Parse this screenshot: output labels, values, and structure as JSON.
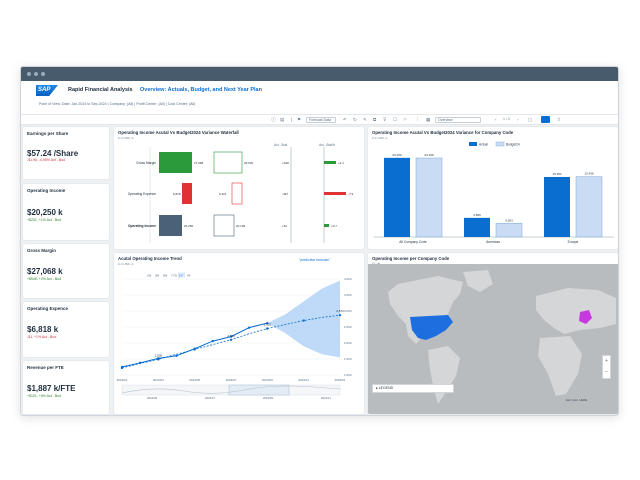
{
  "app": {
    "brand": "SAP",
    "title": "Rapid Financial Analysis",
    "story_title": "Overview: Actuals, Budget, and Next Year Plan",
    "point_of_view": "Point of View: Date: Jan,2024 to Sep,2024 | Company: (All) | Profit Center: (All) | Cost Center: (All)"
  },
  "toolbar": {
    "version_select": "Forecast Data",
    "page_indicator": "1 / 3",
    "page_select": "Overview"
  },
  "colors": {
    "accent": "#0a6ed1",
    "positive": "#2b9a3a",
    "negative": "#e03232",
    "actual_bar": "#0a6ed1",
    "budget_bar": "#c9dcf3",
    "forecast_band": "#a9cdf5",
    "map_highlight": "#1d6fe0",
    "map_highlight_2": "#c738e0"
  },
  "kpis": [
    {
      "title": "Earnings per Share",
      "value": "$57.24 /Share",
      "delta": "-$1.96, -4.95% Act - Bud",
      "trend": "negative"
    },
    {
      "title": "Operating Income",
      "value": "$20,250 k",
      "delta": "+$231, +1% Act - Bud",
      "trend": "positive"
    },
    {
      "title": "Gross Margin",
      "value": "$27,068 k",
      "delta": "+$548, +2% Act - Bud",
      "trend": "positive"
    },
    {
      "title": "Operating Expence",
      "value": "$6,818 k",
      "delta": "-$1, +1% Act - Bud",
      "trend": "negative"
    },
    {
      "title": "Revenue per FTE",
      "value": "$1,887 k/FTE",
      "delta": "+$101, +5% Act - Bud",
      "trend": "positive"
    }
  ],
  "waterfall": {
    "title": "Operating Income Acutal Vs Budget2024 Variance Waterfall",
    "subtitle": "in k USD, A",
    "col_act_bud": "Act - Bud",
    "col_act_budpct": "Act - Bud%",
    "rows": [
      {
        "label": "Gross Margin",
        "actual": "27,068",
        "budget": "26,520",
        "diff": "+548",
        "pct": "+2.1"
      },
      {
        "label": "Operating Expence",
        "actual": "6,818",
        "budget": "6,321",
        "diff": "-497",
        "pct": "-7.9"
      },
      {
        "label": "Operating Income",
        "actual": "20,250",
        "budget": "20,199",
        "diff": "+51",
        "pct": "+0.7"
      }
    ]
  },
  "company_chart": {
    "title": "Operating Income Acutal Vs Budget2024 Variance for Company Code",
    "subtitle": "in k USD, A",
    "legend": [
      "Actual",
      "Budget24"
    ],
    "chart_data": {
      "type": "bar",
      "categories": [
        "All Company Code",
        "Americas",
        "Europe"
      ],
      "series": [
        {
          "name": "Actual",
          "values": [
            20250,
            4896,
            15354
          ]
        },
        {
          "name": "Budget24",
          "values": [
            20199,
            3503,
            15436
          ]
        }
      ],
      "value_labels": [
        [
          "20,250",
          "20,199"
        ],
        [
          "4,896",
          "3,503"
        ],
        [
          "15,354",
          "15,436"
        ]
      ],
      "ylim": [
        0,
        22000
      ]
    }
  },
  "trend_chart": {
    "title": "Acutal Operating Income Trend",
    "subtitle": "in k USD, A",
    "forecast_note": "\"predictive forecast \"",
    "ranges": [
      "1M",
      "3M",
      "6M",
      "YTD",
      "1Y",
      "All"
    ],
    "active_range": "1Y",
    "navigator_labels": [
      "2024/05",
      "2024/07",
      "2024/09",
      "2024/11"
    ],
    "chart_data": {
      "type": "line",
      "x": [
        "2024/01",
        "2024/02",
        "2024/03",
        "2024/04",
        "2024/05",
        "2024/06",
        "2024/07",
        "2024/08",
        "2024/09",
        "2024/10",
        "2024/11",
        "2024/12",
        "2025/01"
      ],
      "x_ticks": [
        "2024/01",
        "2024/03",
        "2024/05",
        "2024/07",
        "2024/09",
        "2024/11",
        "2025/01"
      ],
      "y_ticks": [
        "1,000",
        "1,500",
        "2,000",
        "2,500",
        "3,000",
        "3,500",
        "4,000"
      ],
      "ylim": [
        1000,
        4000
      ],
      "series": [
        {
          "name": "Actual",
          "values": [
            1250,
            1380,
            1520,
            1600,
            1820,
            2060,
            2200,
            2480,
            2620,
            null,
            null,
            null,
            null
          ]
        },
        {
          "name": "Trend",
          "values": [
            1220,
            1360,
            1490,
            1650,
            1800,
            1950,
            2100,
            2290,
            2450,
            2580,
            2700,
            2800,
            2870
          ]
        }
      ],
      "forecast_band": {
        "start_index": 8,
        "upper": [
          2620,
          2900,
          3300,
          3700,
          3950
        ],
        "lower": [
          2620,
          2300,
          1900,
          1650,
          1550
        ]
      },
      "point_labels": [
        {
          "index": 2,
          "label": "1,505"
        },
        {
          "index": 6,
          "label": "2,000"
        },
        {
          "index": 8,
          "label": "2,620"
        },
        {
          "index": 12,
          "label": "2,872"
        }
      ]
    }
  },
  "map": {
    "title": "Operating Income per Company Code",
    "legend_label": "LEGEND",
    "attribution": "Esri | Esri, HERE"
  }
}
